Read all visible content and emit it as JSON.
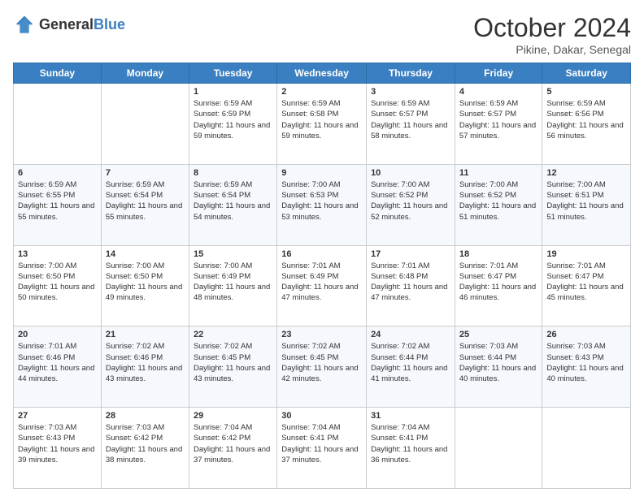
{
  "logo": {
    "general": "General",
    "blue": "Blue"
  },
  "header": {
    "month": "October 2024",
    "location": "Pikine, Dakar, Senegal"
  },
  "weekdays": [
    "Sunday",
    "Monday",
    "Tuesday",
    "Wednesday",
    "Thursday",
    "Friday",
    "Saturday"
  ],
  "weeks": [
    [
      {
        "day": "",
        "sunrise": "",
        "sunset": "",
        "daylight": ""
      },
      {
        "day": "",
        "sunrise": "",
        "sunset": "",
        "daylight": ""
      },
      {
        "day": "1",
        "sunrise": "Sunrise: 6:59 AM",
        "sunset": "Sunset: 6:59 PM",
        "daylight": "Daylight: 11 hours and 59 minutes."
      },
      {
        "day": "2",
        "sunrise": "Sunrise: 6:59 AM",
        "sunset": "Sunset: 6:58 PM",
        "daylight": "Daylight: 11 hours and 59 minutes."
      },
      {
        "day": "3",
        "sunrise": "Sunrise: 6:59 AM",
        "sunset": "Sunset: 6:57 PM",
        "daylight": "Daylight: 11 hours and 58 minutes."
      },
      {
        "day": "4",
        "sunrise": "Sunrise: 6:59 AM",
        "sunset": "Sunset: 6:57 PM",
        "daylight": "Daylight: 11 hours and 57 minutes."
      },
      {
        "day": "5",
        "sunrise": "Sunrise: 6:59 AM",
        "sunset": "Sunset: 6:56 PM",
        "daylight": "Daylight: 11 hours and 56 minutes."
      }
    ],
    [
      {
        "day": "6",
        "sunrise": "Sunrise: 6:59 AM",
        "sunset": "Sunset: 6:55 PM",
        "daylight": "Daylight: 11 hours and 55 minutes."
      },
      {
        "day": "7",
        "sunrise": "Sunrise: 6:59 AM",
        "sunset": "Sunset: 6:54 PM",
        "daylight": "Daylight: 11 hours and 55 minutes."
      },
      {
        "day": "8",
        "sunrise": "Sunrise: 6:59 AM",
        "sunset": "Sunset: 6:54 PM",
        "daylight": "Daylight: 11 hours and 54 minutes."
      },
      {
        "day": "9",
        "sunrise": "Sunrise: 7:00 AM",
        "sunset": "Sunset: 6:53 PM",
        "daylight": "Daylight: 11 hours and 53 minutes."
      },
      {
        "day": "10",
        "sunrise": "Sunrise: 7:00 AM",
        "sunset": "Sunset: 6:52 PM",
        "daylight": "Daylight: 11 hours and 52 minutes."
      },
      {
        "day": "11",
        "sunrise": "Sunrise: 7:00 AM",
        "sunset": "Sunset: 6:52 PM",
        "daylight": "Daylight: 11 hours and 51 minutes."
      },
      {
        "day": "12",
        "sunrise": "Sunrise: 7:00 AM",
        "sunset": "Sunset: 6:51 PM",
        "daylight": "Daylight: 11 hours and 51 minutes."
      }
    ],
    [
      {
        "day": "13",
        "sunrise": "Sunrise: 7:00 AM",
        "sunset": "Sunset: 6:50 PM",
        "daylight": "Daylight: 11 hours and 50 minutes."
      },
      {
        "day": "14",
        "sunrise": "Sunrise: 7:00 AM",
        "sunset": "Sunset: 6:50 PM",
        "daylight": "Daylight: 11 hours and 49 minutes."
      },
      {
        "day": "15",
        "sunrise": "Sunrise: 7:00 AM",
        "sunset": "Sunset: 6:49 PM",
        "daylight": "Daylight: 11 hours and 48 minutes."
      },
      {
        "day": "16",
        "sunrise": "Sunrise: 7:01 AM",
        "sunset": "Sunset: 6:49 PM",
        "daylight": "Daylight: 11 hours and 47 minutes."
      },
      {
        "day": "17",
        "sunrise": "Sunrise: 7:01 AM",
        "sunset": "Sunset: 6:48 PM",
        "daylight": "Daylight: 11 hours and 47 minutes."
      },
      {
        "day": "18",
        "sunrise": "Sunrise: 7:01 AM",
        "sunset": "Sunset: 6:47 PM",
        "daylight": "Daylight: 11 hours and 46 minutes."
      },
      {
        "day": "19",
        "sunrise": "Sunrise: 7:01 AM",
        "sunset": "Sunset: 6:47 PM",
        "daylight": "Daylight: 11 hours and 45 minutes."
      }
    ],
    [
      {
        "day": "20",
        "sunrise": "Sunrise: 7:01 AM",
        "sunset": "Sunset: 6:46 PM",
        "daylight": "Daylight: 11 hours and 44 minutes."
      },
      {
        "day": "21",
        "sunrise": "Sunrise: 7:02 AM",
        "sunset": "Sunset: 6:46 PM",
        "daylight": "Daylight: 11 hours and 43 minutes."
      },
      {
        "day": "22",
        "sunrise": "Sunrise: 7:02 AM",
        "sunset": "Sunset: 6:45 PM",
        "daylight": "Daylight: 11 hours and 43 minutes."
      },
      {
        "day": "23",
        "sunrise": "Sunrise: 7:02 AM",
        "sunset": "Sunset: 6:45 PM",
        "daylight": "Daylight: 11 hours and 42 minutes."
      },
      {
        "day": "24",
        "sunrise": "Sunrise: 7:02 AM",
        "sunset": "Sunset: 6:44 PM",
        "daylight": "Daylight: 11 hours and 41 minutes."
      },
      {
        "day": "25",
        "sunrise": "Sunrise: 7:03 AM",
        "sunset": "Sunset: 6:44 PM",
        "daylight": "Daylight: 11 hours and 40 minutes."
      },
      {
        "day": "26",
        "sunrise": "Sunrise: 7:03 AM",
        "sunset": "Sunset: 6:43 PM",
        "daylight": "Daylight: 11 hours and 40 minutes."
      }
    ],
    [
      {
        "day": "27",
        "sunrise": "Sunrise: 7:03 AM",
        "sunset": "Sunset: 6:43 PM",
        "daylight": "Daylight: 11 hours and 39 minutes."
      },
      {
        "day": "28",
        "sunrise": "Sunrise: 7:03 AM",
        "sunset": "Sunset: 6:42 PM",
        "daylight": "Daylight: 11 hours and 38 minutes."
      },
      {
        "day": "29",
        "sunrise": "Sunrise: 7:04 AM",
        "sunset": "Sunset: 6:42 PM",
        "daylight": "Daylight: 11 hours and 37 minutes."
      },
      {
        "day": "30",
        "sunrise": "Sunrise: 7:04 AM",
        "sunset": "Sunset: 6:41 PM",
        "daylight": "Daylight: 11 hours and 37 minutes."
      },
      {
        "day": "31",
        "sunrise": "Sunrise: 7:04 AM",
        "sunset": "Sunset: 6:41 PM",
        "daylight": "Daylight: 11 hours and 36 minutes."
      },
      {
        "day": "",
        "sunrise": "",
        "sunset": "",
        "daylight": ""
      },
      {
        "day": "",
        "sunrise": "",
        "sunset": "",
        "daylight": ""
      }
    ]
  ]
}
